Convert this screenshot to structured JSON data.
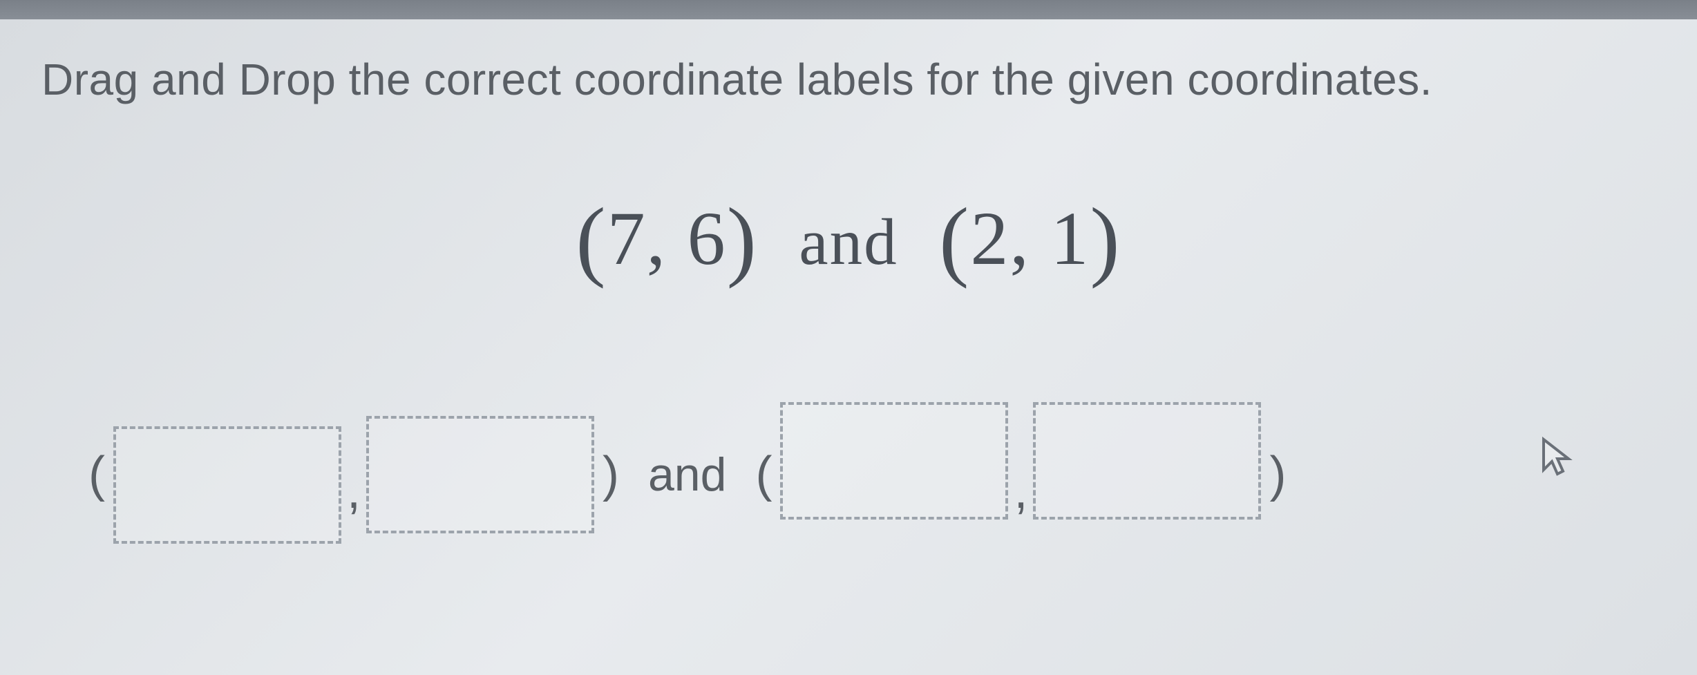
{
  "instruction": "Drag and Drop the correct coordinate labels for the given coordinates.",
  "coordinates": {
    "pair1": {
      "x": "7",
      "y": "6"
    },
    "pair2": {
      "x": "2",
      "y": "1"
    },
    "connector": "and"
  },
  "answer_row": {
    "open_paren": "(",
    "close_paren": ")",
    "comma": ",",
    "connector": "and"
  }
}
